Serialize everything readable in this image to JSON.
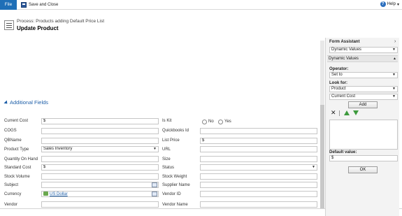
{
  "ribbon": {
    "file_label": "File",
    "save_close_label": "Save and Close",
    "help_label": "Help"
  },
  "header": {
    "process_text": "Process: Products adding Default Price List",
    "form_title": "Update Product"
  },
  "section": {
    "title": "Additional Fields"
  },
  "fields_left": [
    {
      "label": "Current Cost",
      "value": "$"
    },
    {
      "label": "COGS",
      "value": ""
    },
    {
      "label": "QBName",
      "value": ""
    },
    {
      "label": "Product Type",
      "value": "Sales Inventory"
    },
    {
      "label": "Quantity On Hand",
      "value": ""
    },
    {
      "label": "Standard Cost",
      "value": "$"
    },
    {
      "label": "Stock Volume",
      "value": ""
    },
    {
      "label": "Subject",
      "value": ""
    },
    {
      "label": "Currency",
      "value": "US Dollar"
    },
    {
      "label": "Vendor",
      "value": ""
    }
  ],
  "fields_right": [
    {
      "label": "Is Kit",
      "value": ""
    },
    {
      "label": "Quickbooks Id",
      "value": ""
    },
    {
      "label": "List Price",
      "value": "$"
    },
    {
      "label": "URL",
      "value": ""
    },
    {
      "label": "Size",
      "value": ""
    },
    {
      "label": "Status",
      "value": ""
    },
    {
      "label": "Stock Weight",
      "value": ""
    },
    {
      "label": "Supplier Name",
      "value": ""
    },
    {
      "label": "Vendor ID",
      "value": ""
    },
    {
      "label": "Vendor Name",
      "value": ""
    }
  ],
  "is_kit_options": [
    "No",
    "Yes"
  ],
  "form_assistant": {
    "title": "Form Assistant",
    "top_select": "Dynamic Values",
    "subheader": "Dynamic Values",
    "operator_label": "Operator:",
    "operator_value": "Set to",
    "look_for_label": "Look for:",
    "look_for_entity": "Product",
    "look_for_field": "Current Cost",
    "add_label": "Add",
    "default_value_label": "Default value:",
    "default_value": "$",
    "ok_label": "OK"
  },
  "colors": {
    "accent": "#1f6fb7",
    "section_title": "#1e5fa8",
    "panel_bg": "#f3f3f3"
  }
}
